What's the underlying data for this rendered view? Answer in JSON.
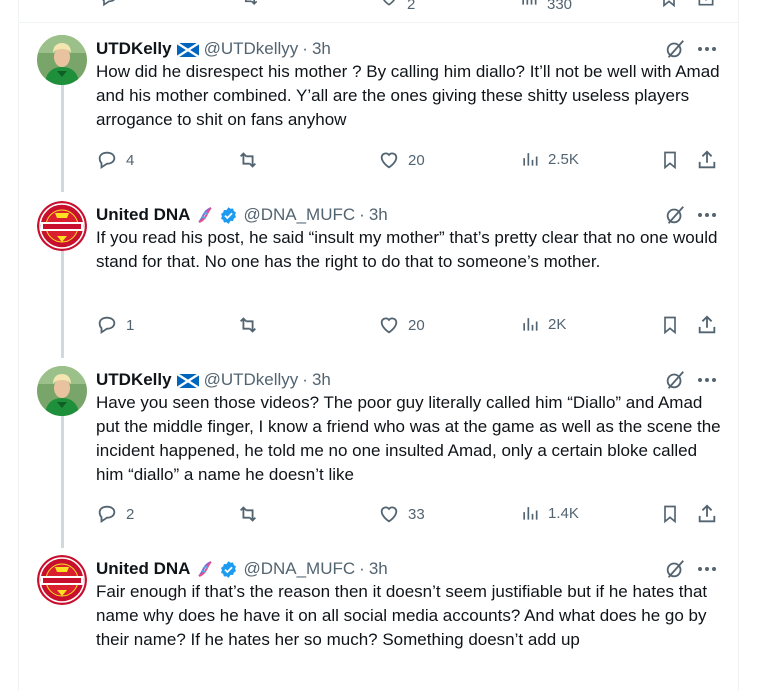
{
  "tweets": [
    {
      "name": "UTDKelly",
      "handle": "@UTDkellyy",
      "time": "3h",
      "text": "How did he disrespect his mother ? By calling him diallo? It’ll not be well with Amad and his mother combined. Y’all are the ones giving these shitty useless players arrogance to shit on fans anyhow",
      "replies": "4",
      "reposts": "",
      "likes": "20",
      "views": "2.5K",
      "avatar_icon": "goalkeeper-avatar",
      "badge_icon": "scotland-flag-icon"
    },
    {
      "name": "United DNA",
      "handle": "@DNA_MUFC",
      "time": "3h",
      "text": "If you read his post, he said “insult my mother” that’s pretty clear that no one would stand for that. No one  has the right to do that to someone’s mother.",
      "replies": "1",
      "reposts": "",
      "likes": "20",
      "views": "2K",
      "avatar_icon": "united-dna-logo",
      "badge_icon": "dna-emoji-icon",
      "verified": true
    },
    {
      "name": "UTDKelly",
      "handle": "@UTDkellyy",
      "time": "3h",
      "text": "Have you seen those videos? The poor guy literally called him “Diallo” and Amad put the middle finger, I know a friend who was at the game as well as the scene the incident happened, he told me no one insulted Amad, only a certain bloke called him “diallo” a name he doesn’t like",
      "replies": "2",
      "reposts": "",
      "likes": "33",
      "views": "1.4K",
      "avatar_icon": "goalkeeper-avatar",
      "badge_icon": "scotland-flag-icon"
    },
    {
      "name": "United DNA",
      "handle": "@DNA_MUFC",
      "time": "3h",
      "text": "Fair enough if that’s the reason then it doesn’t seem justifiable but if he hates that name why does he have it on all social media accounts? And what does he go by their name? If he hates her so much? Something doesn’t add up",
      "avatar_icon": "united-dna-logo",
      "badge_icon": "dna-emoji-icon",
      "verified": true
    }
  ],
  "separator": "·",
  "top_row_counts": {
    "likes": "2",
    "views": "330"
  },
  "colors": {
    "text": "#0f1419",
    "secondary": "#536471",
    "verified": "#1d9bf0",
    "thread_line": "#cfd9de",
    "border": "#eff3f4"
  }
}
